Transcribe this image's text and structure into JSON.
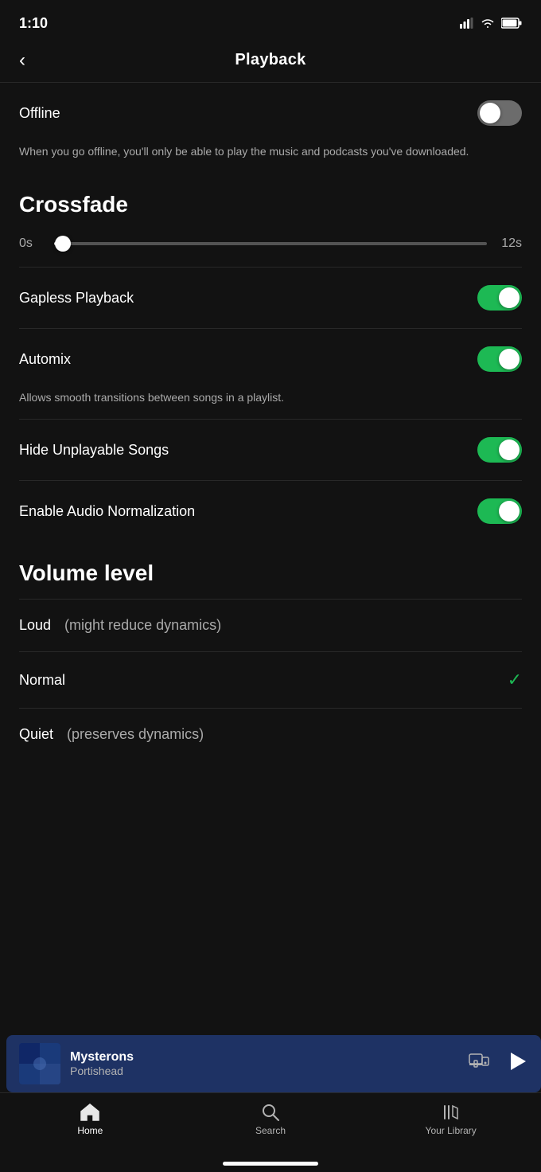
{
  "statusBar": {
    "time": "1:10"
  },
  "header": {
    "back_label": "<",
    "title": "Playback"
  },
  "settings": {
    "offline": {
      "label": "Offline",
      "description": "When you go offline, you'll only be able to play the music and podcasts you've downloaded.",
      "enabled": false
    },
    "crossfade": {
      "section_title": "Crossfade",
      "min_label": "0s",
      "max_label": "12s",
      "value": 0
    },
    "gapless_playback": {
      "label": "Gapless Playback",
      "enabled": true
    },
    "automix": {
      "label": "Automix",
      "enabled": true,
      "description": "Allows smooth transitions between songs in a playlist."
    },
    "hide_unplayable": {
      "label": "Hide Unplayable Songs",
      "enabled": true
    },
    "audio_normalization": {
      "label": "Enable Audio Normalization",
      "enabled": true
    },
    "volume_level": {
      "section_title": "Volume level",
      "options": [
        {
          "label": "Loud",
          "sublabel": "(might reduce dynamics)",
          "selected": false
        },
        {
          "label": "Normal",
          "sublabel": "",
          "selected": true
        },
        {
          "label": "Quiet",
          "sublabel": "(preserves dynamics)",
          "selected": false
        }
      ]
    }
  },
  "nowPlaying": {
    "title": "Mysterons",
    "artist": "Portishead"
  },
  "bottomNav": {
    "items": [
      {
        "id": "home",
        "label": "Home",
        "active": false,
        "icon": "home"
      },
      {
        "id": "search",
        "label": "Search",
        "active": false,
        "icon": "search"
      },
      {
        "id": "library",
        "label": "Your Library",
        "active": false,
        "icon": "library"
      }
    ]
  }
}
